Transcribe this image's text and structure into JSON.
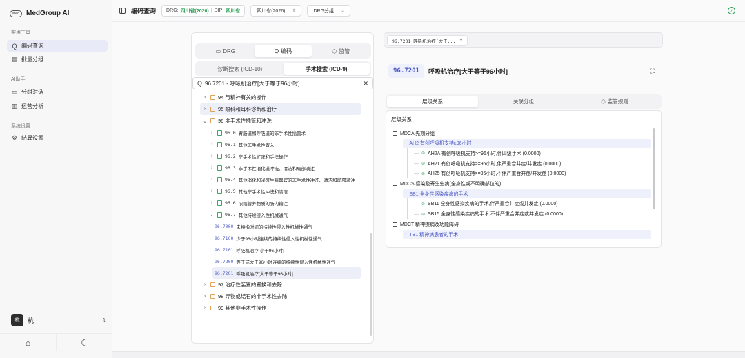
{
  "brand": {
    "logo_text": "Med",
    "name": "MedGroup AI"
  },
  "sidebar": {
    "sections": [
      {
        "label": "实用工具",
        "items": [
          {
            "icon": "search-icon",
            "glyph": "Q",
            "label": "编码查询",
            "active": true
          },
          {
            "icon": "doc-icon",
            "glyph": "▤",
            "label": "批量分组",
            "active": false
          }
        ]
      },
      {
        "label": "AI助手",
        "items": [
          {
            "icon": "chat-icon",
            "glyph": "▭",
            "label": "分组对话",
            "active": false
          },
          {
            "icon": "chart-icon",
            "glyph": "▥",
            "label": "运营分析",
            "active": false
          }
        ]
      },
      {
        "label": "系统设置",
        "items": [
          {
            "icon": "gear-icon",
            "glyph": "⚙",
            "label": "结算设置",
            "active": false
          }
        ]
      }
    ],
    "user": {
      "initial": "杭",
      "name": "杭"
    }
  },
  "topbar": {
    "title": "编码查询",
    "drg_label": "DRG:",
    "drg_value": "四川省(2026)",
    "dip_label": "DIP:",
    "dip_value": "四川省",
    "region_select": "四川省(2026)",
    "group_select": "DRG分组"
  },
  "left": {
    "mode_tabs": [
      {
        "label": "DRG",
        "glyph": "▭",
        "active": false
      },
      {
        "label": "编码",
        "glyph": "Q",
        "active": true
      },
      {
        "label": "监管",
        "glyph": "⬡",
        "active": false
      }
    ],
    "search_tabs": [
      {
        "label": "诊断搜索 (ICD-10)",
        "active": false
      },
      {
        "label": "手术搜索 (ICD-9)",
        "active": true
      }
    ],
    "search_value": "96.7201 - 呼吸机治疗[大于等于96小时]",
    "tree": [
      {
        "level": 0,
        "type": "folder",
        "arrow": "›",
        "text": "94 与精神有关的操作"
      },
      {
        "level": 0,
        "type": "folder",
        "arrow": "›",
        "text": "95 眼科和耳科诊断和治疗",
        "hl": true
      },
      {
        "level": 0,
        "type": "folder",
        "arrow": "⌄",
        "text": "96 非手术性插管和冲洗"
      },
      {
        "level": 1,
        "type": "file",
        "arrow": "›",
        "code": "96.0",
        "text": "胃肠道和呼吸道的非手术性插管术"
      },
      {
        "level": 1,
        "type": "file",
        "arrow": "›",
        "code": "96.1",
        "text": "其他非手术性置入"
      },
      {
        "level": 1,
        "type": "file",
        "arrow": "›",
        "code": "96.2",
        "text": "非手术性扩张和手法操作"
      },
      {
        "level": 1,
        "type": "file",
        "arrow": "›",
        "code": "96.3",
        "text": "非手术性消化道冲洗、清洁和局部滴注"
      },
      {
        "level": 1,
        "type": "file",
        "arrow": "›",
        "code": "96.4",
        "text": "其他消化和泌尿生殖器官的非手术性冲洗、清洁和局部滴注"
      },
      {
        "level": 1,
        "type": "file",
        "arrow": "›",
        "code": "96.5",
        "text": "其他非手术性冲洗和清洁"
      },
      {
        "level": 1,
        "type": "file",
        "arrow": "›",
        "code": "96.6",
        "text": "浓缩营养物质的肠内输注"
      },
      {
        "level": 1,
        "type": "file",
        "arrow": "⌄",
        "code": "96.7",
        "text": "其他持续侵入性机械通气"
      },
      {
        "level": 2,
        "type": "leaf",
        "code": "96.7000",
        "text": "未特指时间的持续性侵入性机械性通气"
      },
      {
        "level": 2,
        "type": "leaf",
        "code": "96.7100",
        "text": "少于96小时连续的持续性侵入性机械性通气"
      },
      {
        "level": 2,
        "type": "leaf",
        "code": "96.7101",
        "text": "呼吸机治疗[小于96小时]"
      },
      {
        "level": 2,
        "type": "leaf",
        "code": "96.7200",
        "text": "等于或大于96小时连续的持续性侵入性机械性通气"
      },
      {
        "level": 2,
        "type": "leaf",
        "code": "96.7201",
        "text": "呼吸机治疗[大于等于96小时]",
        "hl": true
      },
      {
        "level": 0,
        "type": "folder",
        "arrow": "›",
        "text": "97 治疗性装置的置换和去除"
      },
      {
        "level": 0,
        "type": "folder",
        "arrow": "›",
        "text": "98 异物或结石的非手术性去除"
      },
      {
        "level": 0,
        "type": "folder",
        "arrow": "›",
        "text": "99 其他非手术性操作"
      }
    ]
  },
  "detail": {
    "open_tab": "96.7201 呼吸机治疗[大于...",
    "code": "96.7201",
    "title": "呼吸机治疗[大于等于96小时]",
    "tabs": [
      {
        "label": "层级关系",
        "glyph": "",
        "active": true
      },
      {
        "label": "关联分组",
        "glyph": "",
        "active": false
      },
      {
        "label": "监管规则",
        "glyph": "⬡",
        "active": false
      }
    ],
    "hier_title": "层级关系",
    "hierarchy": [
      {
        "kind": "mdc",
        "text": "MDCA 先期分组"
      },
      {
        "kind": "adrg",
        "text": "AH2 有创呼吸机支持≥96小时"
      },
      {
        "kind": "drg",
        "text": "AH2A 有创呼吸机支持>=96小时,伴四级手术 (0.0000)"
      },
      {
        "kind": "drg",
        "text": "AH21 有创呼吸机支持>=96小时,伴严重合并症/并发症 (0.0000)"
      },
      {
        "kind": "drg",
        "text": "AH25 有创呼吸机支持>=96小时,不伴严重合并症/并发症 (0.0000)"
      },
      {
        "kind": "mdc",
        "text": "MDCS 感染及寄生虫病(全身性或不明确部位的)"
      },
      {
        "kind": "adrg",
        "text": "SB1 全身性感染疾病的手术"
      },
      {
        "kind": "drg",
        "text": "SB11 全身性感染疾病的手术,伴严重合并症或并发症 (0.0000)"
      },
      {
        "kind": "drg",
        "text": "SB15 全身性感染疾病的手术,不伴严重合并症或并发症 (0.0000)"
      },
      {
        "kind": "mdc",
        "text": "MDCT 精神疾病及功能障碍"
      },
      {
        "kind": "adrg",
        "text": "TB1 精神病患者的手术"
      }
    ]
  }
}
